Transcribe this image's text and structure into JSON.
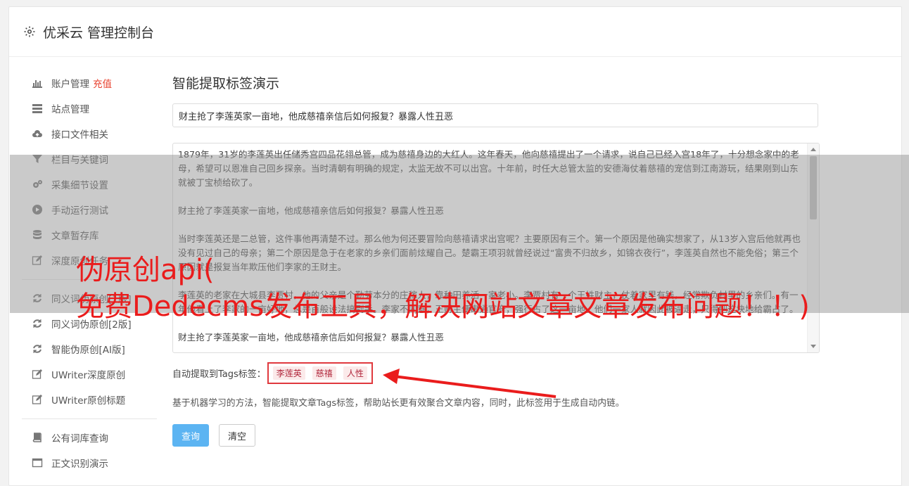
{
  "header": {
    "title": "优采云 管理控制台",
    "icon": "gear-icon"
  },
  "sidebar": {
    "group1": [
      {
        "label": "账户管理",
        "badge": "充值",
        "icon": "bar-chart-icon"
      },
      {
        "label": "站点管理",
        "icon": "server-icon"
      },
      {
        "label": "接口文件相关",
        "icon": "cloud-upload-icon"
      },
      {
        "label": "栏目与关键词",
        "icon": "filter-icon"
      },
      {
        "label": "采集细节设置",
        "icon": "gears-icon"
      },
      {
        "label": "手动运行测试",
        "icon": "play-circle-icon"
      },
      {
        "label": "文章暂存库",
        "icon": "database-icon"
      },
      {
        "label": "深度原创任务",
        "icon": "edit-icon"
      }
    ],
    "group2": [
      {
        "label": "同义词伪原创[1版]",
        "icon": "refresh-icon"
      },
      {
        "label": "同义词伪原创[2版]",
        "icon": "refresh-icon"
      },
      {
        "label": "智能伪原创[AI版]",
        "icon": "refresh-icon"
      },
      {
        "label": "UWriter深度原创",
        "icon": "edit-icon"
      },
      {
        "label": "UWriter原创标题",
        "icon": "edit-icon"
      }
    ],
    "group3": [
      {
        "label": "公有词库查询",
        "icon": "book-icon"
      },
      {
        "label": "正文识别演示",
        "icon": "window-icon"
      }
    ]
  },
  "main": {
    "title": "智能提取标签演示",
    "title_input": "财主抢了李莲英家一亩地，他成慈禧亲信后如何报复？暴露人性丑恶",
    "content": [
      "1879年，31岁的李莲英出任储秀宫四品花翎总管，成为慈禧身边的大红人。这年春天，他向慈禧提出了一个请求，说自己已经入宫18年了，十分想念家中的老母，希望可以恩准自己回乡探亲。当时清朝有明确的规定，太监无故不可以出宫。十年前，时任大总管太监的安德海仗着慈禧的宠信到江南游玩，结果刚到山东就被丁宝桢给砍了。",
      "财主抢了李莲英家一亩地，他成慈禧亲信后如何报复？暴露人性丑恶",
      "当时李莲英还是二总管，这件事他再清楚不过。那么他为何还要冒险向慈禧请求出宫呢？主要原因有三个。第一个原因是他确实想家了，从13岁入宫后他就再也没有见过自己的母亲；第二个原因是急于在老家的乡亲们面前炫耀自己。楚霸王项羽就曾经说过“富贵不归故乡，如锦衣夜行”，李莲英自然也不能免俗；第三个原因就是报复当年欺压他们李家的王财主。",
      "李莲英的老家在大城县李贾村，他的父亲是个勤劳本分的庄稼人，靠种田养活一家老小。李贾村有一个王姓财主，仗着家里有钱，经常欺负村里的乡亲们。有一年他看上了李家的一亩好地，总是百般设法搞到手。李家不同意，王财主便串通官府，强行占了这一亩地。他们一家人就因此被逼走，只得把这块地给霸占了。",
      "财主抢了李莲英家一亩地，他成慈禧亲信后如何报复？暴露人性丑恶"
    ],
    "tags_label": "自动提取到Tags标签：",
    "tags": [
      "李莲英",
      "慈禧",
      "人性"
    ],
    "description": "基于机器学习的方法，智能提取文章Tags标签，帮助站长更有效聚合文章内容，同时，此标签用于生成自动内链。",
    "query_button": "查询",
    "clear_button": "清空"
  },
  "overlay": {
    "line1": "伪原创api(",
    "line2": "免费Dedecms发布工具，解决网站文章文章发布问题！！)"
  },
  "colors": {
    "accent": "#5cb4f2",
    "red": "#ea1c1c",
    "tag_border": "#e0393e"
  }
}
